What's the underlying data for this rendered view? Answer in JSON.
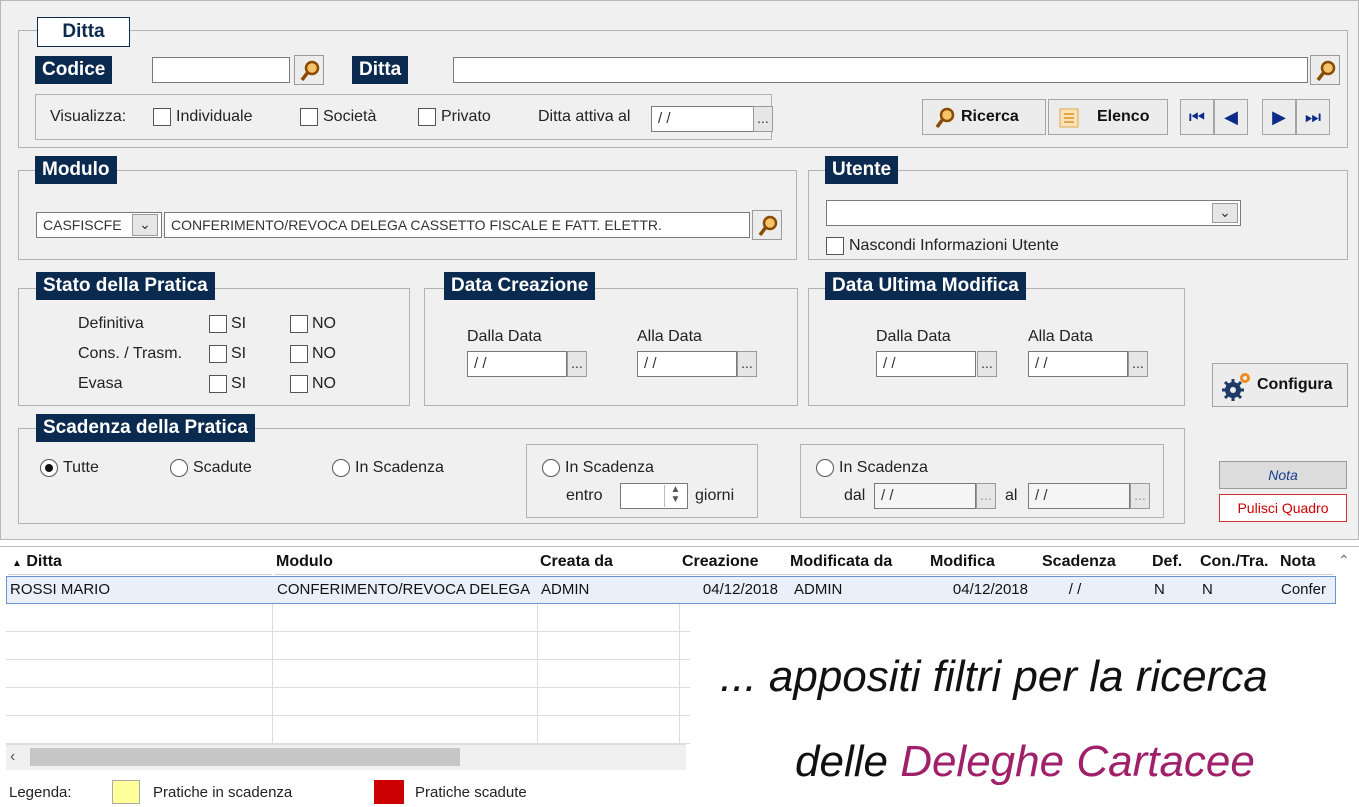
{
  "ditta_section": {
    "tab": "Ditta",
    "codice_label": "Codice",
    "codice_value": "",
    "ditta_label": "Ditta",
    "ditta_value": "",
    "visualizza_label": "Visualizza:",
    "individuale": "Individuale",
    "societa": "Società",
    "privato": "Privato",
    "ditta_attiva_label": "Ditta attiva al",
    "ditta_attiva_value": " / /",
    "ellipsis": "...",
    "ricerca": "Ricerca",
    "elenco": "Elenco"
  },
  "modulo_section": {
    "title": "Modulo",
    "code": "CASFISCFE",
    "description": "CONFERIMENTO/REVOCA DELEGA CASSETTO FISCALE E FATT. ELETTR."
  },
  "utente_section": {
    "title": "Utente",
    "value": "",
    "hide_label": "Nascondi Informazioni Utente"
  },
  "stato_section": {
    "title": "Stato della Pratica",
    "rows": [
      {
        "label": "Definitiva",
        "si": "SI",
        "no": "NO"
      },
      {
        "label": "Cons. / Trasm.",
        "si": "SI",
        "no": "NO"
      },
      {
        "label": "Evasa",
        "si": "SI",
        "no": "NO"
      }
    ]
  },
  "data_creazione": {
    "title": "Data Creazione",
    "dalla": "Dalla Data",
    "alla": "Alla Data",
    "dalla_value": " / /",
    "alla_value": " / /"
  },
  "data_modifica": {
    "title": "Data Ultima Modifica",
    "dalla": "Dalla Data",
    "alla": "Alla Data",
    "dalla_value": " / /",
    "alla_value": " / /"
  },
  "configura": "Configura",
  "scadenza_section": {
    "title": "Scadenza della Pratica",
    "tutte": "Tutte",
    "scadute": "Scadute",
    "in_scadenza": "In Scadenza",
    "in_scadenza_entro": "In Scadenza",
    "entro": "entro",
    "giorni": "giorni",
    "in_scadenza_dal": "In Scadenza",
    "dal": "dal",
    "al": "al",
    "dal_value": " / /",
    "al_value": " / /"
  },
  "nota_button": "Nota",
  "pulisci_button": "Pulisci Quadro",
  "grid": {
    "headers": [
      "Ditta",
      "Modulo",
      "Creata da",
      "Creazione",
      "Modificata da",
      "Modifica",
      "Scadenza",
      "Def.",
      "Con./Tra.",
      "Nota"
    ],
    "rows": [
      [
        "ROSSI MARIO",
        "CONFERIMENTO/REVOCA DELEGA",
        "ADMIN",
        "04/12/2018",
        "ADMIN",
        "04/12/2018",
        " / /",
        "N",
        "N",
        "Confer"
      ]
    ]
  },
  "legend": {
    "label": "Legenda:",
    "in_scadenza": "Pratiche in scadenza",
    "scadute": "Pratiche scadute",
    "yellow": "#ffff99",
    "red": "#cc0000"
  },
  "overlay": {
    "line1": "... appositi filtri per la ricerca",
    "line2_prefix": "delle ",
    "line2_highlight": "Deleghe Cartacee",
    "highlight_color": "#a0206a"
  }
}
